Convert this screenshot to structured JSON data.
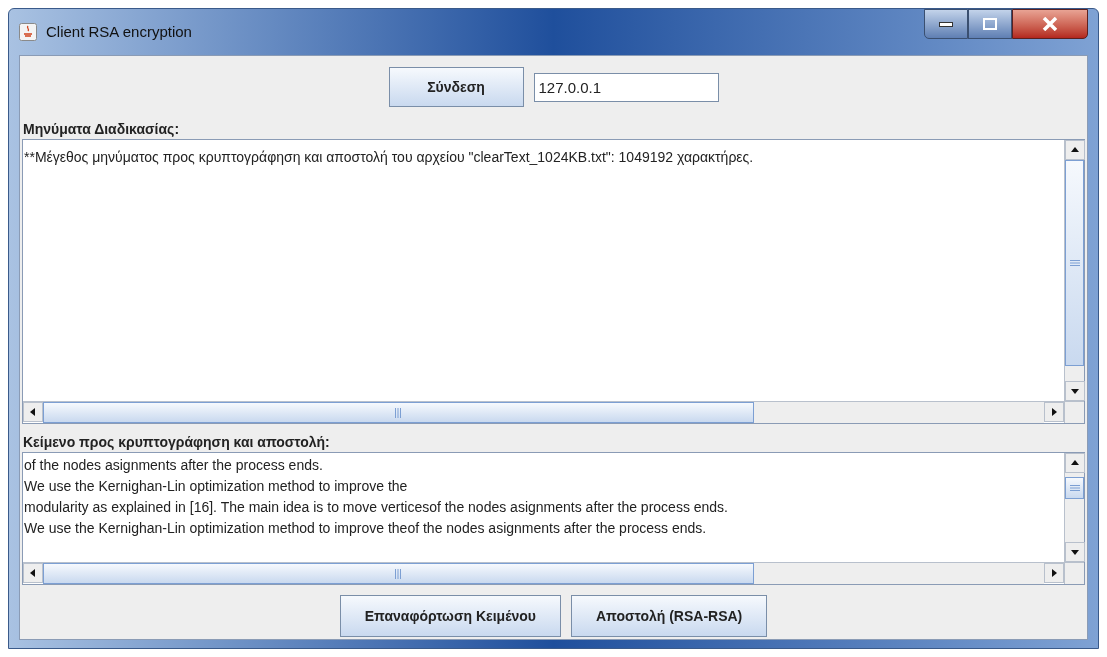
{
  "window": {
    "title": "Client RSA encryption"
  },
  "connect_button": "Σύνδεση",
  "address_field": {
    "value": "127.0.0.1"
  },
  "log": {
    "label": "Μηνύματα Διαδικασίας:",
    "lines": [
      "**Μέγεθος μηνύματος προς κρυπτογράφηση και αποστολή του αρχείου \"clearText_1024KB.txt\": 1049192 χαρακτήρες."
    ]
  },
  "message": {
    "label": "Κείμενο προς κρυπτογράφηση και αποστολή:",
    "lines": [
      "of the nodes asignments after the process ends.",
      "We use the Kernighan-Lin optimization method to improve the",
      "modularity as explained in [16]. The main idea is to move verticesof the nodes asignments after the process ends.",
      "We use the Kernighan-Lin optimization method to improve theof the nodes asignments after the process ends."
    ]
  },
  "buttons": [
    "Επαναφόρτωση Κειμένου",
    "Αποστολή (RSA-RSA)"
  ]
}
